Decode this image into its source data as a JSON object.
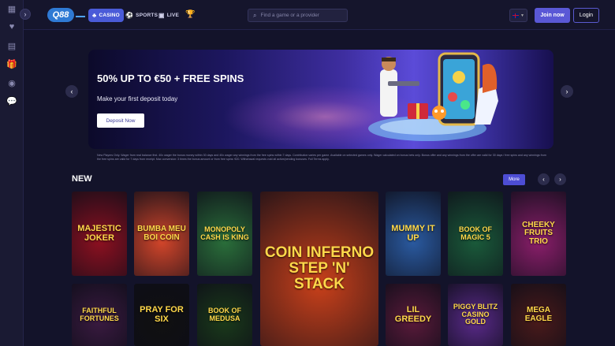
{
  "sidebar": {
    "icons": [
      "grid-icon",
      "heart-icon",
      "slot-icon",
      "gift-icon",
      "chip-icon",
      "chat-icon"
    ],
    "collapse_icon": "chevron-right-icon"
  },
  "topbar": {
    "logo": "Q88",
    "tabs": [
      {
        "label": "CASINO",
        "icon": "casino-icon",
        "active": true
      },
      {
        "label": "SPORTS",
        "icon": "football-icon",
        "active": false
      },
      {
        "label": "LIVE",
        "icon": "live-icon",
        "active": false
      }
    ],
    "trophy_icon": "trophy-icon",
    "search": {
      "placeholder": "Find a game or a provider"
    },
    "language": {
      "flag": "uk-flag-icon"
    },
    "join_label": "Join now",
    "login_label": "Login"
  },
  "banner": {
    "title": "50% UP TO €50 + FREE SPINS",
    "subtitle": "Make your first deposit today",
    "button_label": "Deposit Now",
    "terms": "New Players Only. Wager from real balance first. 40x wager the bonus money within 30 days and 40x wager any winnings from the free spins within 7 days. Contribution varies per game. Available on selected games only. Wager calculated on bonus bets only. Bonus offer and any winnings from the offer are valid for 30 days / free spins and any winnings from the free spins are valid for 7 days from receipt. Max conversion: 3 times the bonus amount or from free spins: €20. Withdrawal requests void all active/pending bonuses. Full Terms apply."
  },
  "new_section": {
    "title": "NEW",
    "more_label": "More",
    "games": [
      {
        "title": "MAJESTIC JOKER",
        "color": "#8c1020"
      },
      {
        "title": "BUMBA MEU BOI COIN",
        "color": "#d1452a"
      },
      {
        "title": "MONOPOLY CASH IS KING",
        "color": "#2a6e3a"
      },
      {
        "title": "COIN INFERNO STEP 'N' STACK",
        "color": "#c8401a"
      },
      {
        "title": "MUMMY IT UP",
        "color": "#2a5aa0"
      },
      {
        "title": "BOOK OF MAGIC 5",
        "color": "#1a5a3a"
      },
      {
        "title": "CHEEKY FRUITS TRIO",
        "color": "#8a1e6a"
      },
      {
        "title": "FAITHFUL FORTUNES",
        "color": "#3a1a40"
      },
      {
        "title": "PRAY FOR SIX",
        "color": "#101010"
      },
      {
        "title": "BOOK OF MEDUSA",
        "color": "#1a3a1a"
      },
      {
        "title": "LIL GREEDY",
        "color": "#5a1a3a"
      },
      {
        "title": "PIGGY BLITZ CASINO GOLD",
        "color": "#5a2a8a"
      },
      {
        "title": "MEGA EAGLE",
        "color": "#4a1a1a"
      }
    ]
  }
}
